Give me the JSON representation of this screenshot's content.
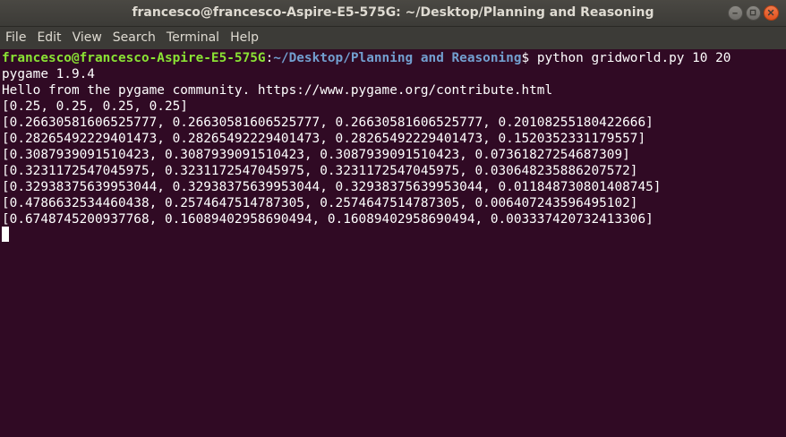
{
  "window": {
    "title": "francesco@francesco-Aspire-E5-575G: ~/Desktop/Planning and Reasoning",
    "colors": {
      "background": "#300a24",
      "prompt_user": "#8ae234",
      "prompt_path": "#729fcf",
      "text": "#ffffff"
    }
  },
  "menu": {
    "items": [
      {
        "label": "File"
      },
      {
        "label": "Edit"
      },
      {
        "label": "View"
      },
      {
        "label": "Search"
      },
      {
        "label": "Terminal"
      },
      {
        "label": "Help"
      }
    ]
  },
  "terminal": {
    "prompt": {
      "user_host": "francesco@francesco-Aspire-E5-575G",
      "colon": ":",
      "path": "~/Desktop/Planning and Reasoning",
      "dollar": "$ ",
      "command": "python gridworld.py 10 20"
    },
    "output": [
      "pygame 1.9.4",
      "Hello from the pygame community. https://www.pygame.org/contribute.html",
      "[0.25, 0.25, 0.25, 0.25]",
      "[0.26630581606525777, 0.26630581606525777, 0.26630581606525777, 0.20108255180422666]",
      "[0.28265492229401473, 0.28265492229401473, 0.28265492229401473, 0.1520352331179557]",
      "[0.3087939091510423, 0.3087939091510423, 0.3087939091510423, 0.07361827254687309]",
      "[0.3231172547045975, 0.3231172547045975, 0.3231172547045975, 0.030648235886207572]",
      "[0.32938375639953044, 0.32938375639953044, 0.32938375639953044, 0.011848730801408745]",
      "[0.4786632534460438, 0.2574647514787305, 0.2574647514787305, 0.006407243596495102]",
      "[0.6748745200937768, 0.16089402958690494, 0.16089402958690494, 0.003337420732413306]"
    ]
  }
}
